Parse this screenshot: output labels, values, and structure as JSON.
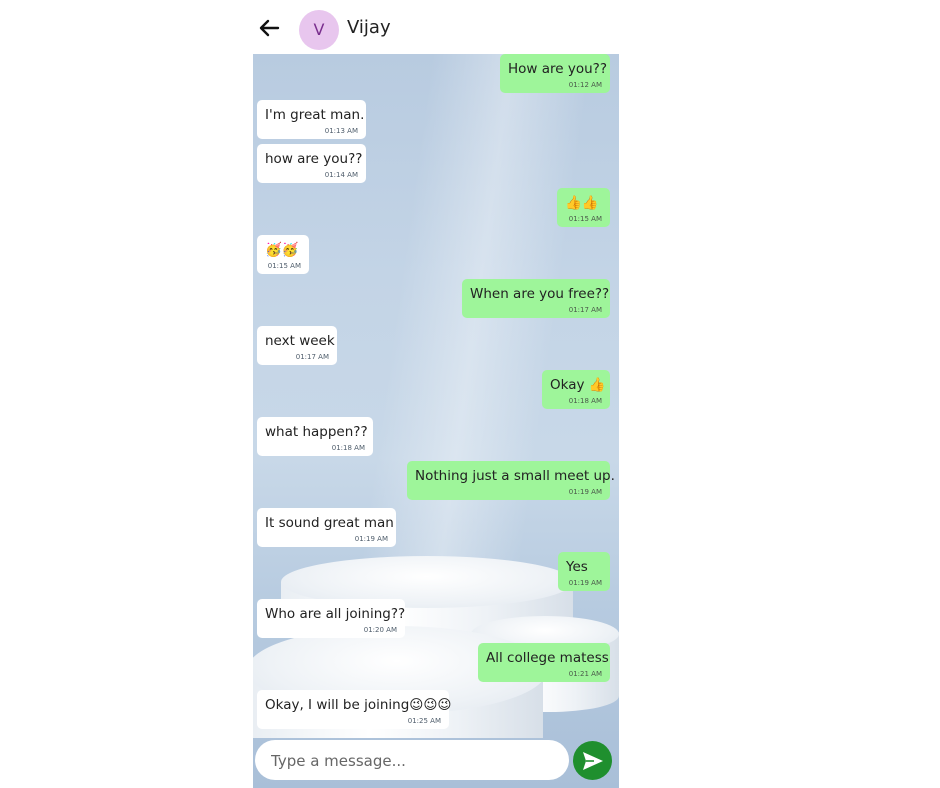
{
  "header": {
    "back_icon": "arrow-left-icon",
    "avatar_initial": "V",
    "contact_name": "Vijay",
    "avatar_color": "#e8c6ee"
  },
  "colors": {
    "outgoing_bubble": "#9ef59a",
    "incoming_bubble": "#ffffff",
    "send_button": "#1f8f2e"
  },
  "messages": [
    {
      "dir": "out",
      "text": "How are you??",
      "time": "01:12 AM"
    },
    {
      "dir": "in",
      "text": "I'm great man.",
      "time": "01:13 AM"
    },
    {
      "dir": "in",
      "text": "how are you??",
      "time": "01:14 AM"
    },
    {
      "dir": "out",
      "text": "👍👍",
      "time": "01:15 AM"
    },
    {
      "dir": "in",
      "text": "🥳🥳",
      "time": "01:15 AM"
    },
    {
      "dir": "out",
      "text": "When are you free??",
      "time": "01:17 AM"
    },
    {
      "dir": "in",
      "text": "next week",
      "time": "01:17 AM"
    },
    {
      "dir": "out",
      "text": "Okay 👍",
      "time": "01:18 AM"
    },
    {
      "dir": "in",
      "text": "what happen??",
      "time": "01:18 AM"
    },
    {
      "dir": "out",
      "text": "Nothing just a small meet up.",
      "time": "01:19 AM"
    },
    {
      "dir": "in",
      "text": "It sound great man",
      "time": "01:19 AM"
    },
    {
      "dir": "out",
      "text": "Yes",
      "time": "01:19 AM"
    },
    {
      "dir": "in",
      "text": "Who are all joining??",
      "time": "01:20 AM"
    },
    {
      "dir": "out",
      "text": "All college matess",
      "time": "01:21 AM"
    },
    {
      "dir": "in",
      "text": "Okay, I will be joining😉😉😉",
      "time": "01:25 AM"
    }
  ],
  "composer": {
    "placeholder": "Type a message...",
    "value": "",
    "send_icon": "send-icon"
  }
}
